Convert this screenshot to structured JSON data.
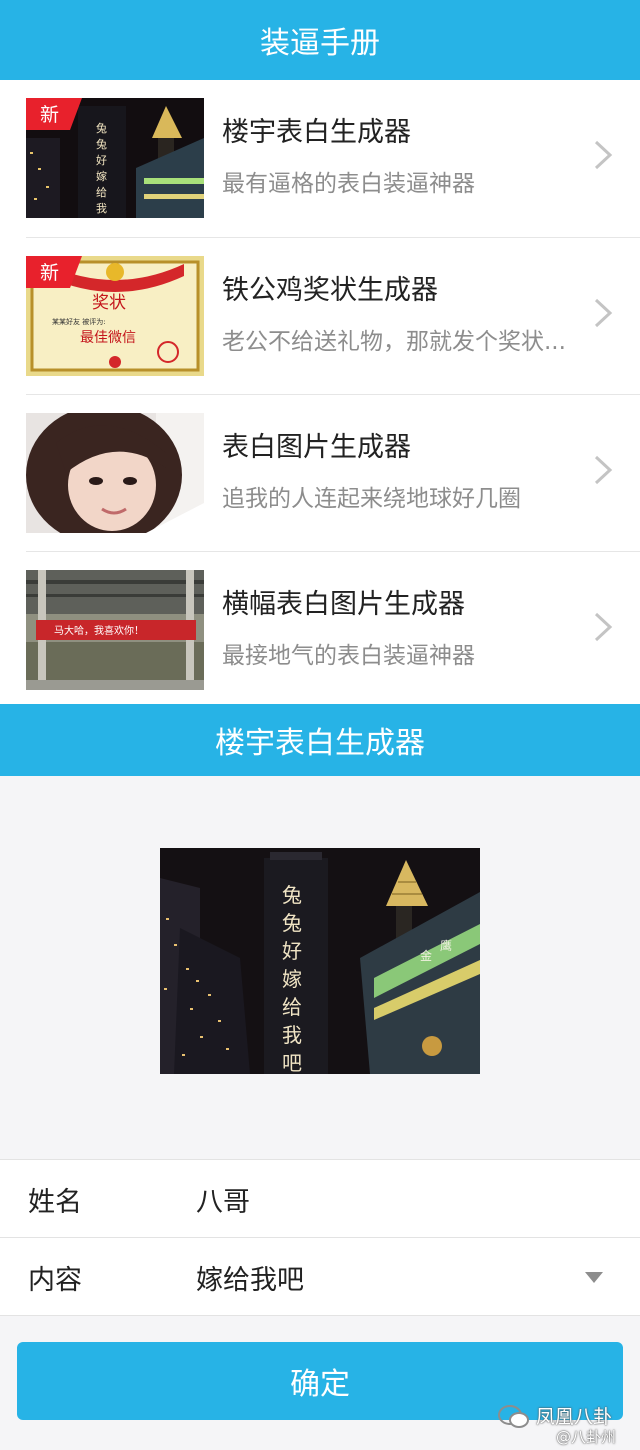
{
  "header": {
    "title": "装逼手册"
  },
  "list": {
    "items": [
      {
        "title": "楼宇表白生成器",
        "desc": "最有逼格的表白装逼神器",
        "badge": "新",
        "thumb_icon": "building-night-image"
      },
      {
        "title": "铁公鸡奖状生成器",
        "desc": "老公不给送礼物，那就发个奖状...",
        "badge": "新",
        "thumb_icon": "certificate-image",
        "thumb_texts": {
          "heading": "奖状",
          "line": "某某好友 被评为:",
          "award": "最佳微信"
        }
      },
      {
        "title": "表白图片生成器",
        "desc": "追我的人连起来绕地球好几圈",
        "thumb_icon": "portrait-photo"
      },
      {
        "title": "横幅表白图片生成器",
        "desc": "最接地气的表白装逼神器",
        "thumb_icon": "banner-photo",
        "thumb_texts": {
          "banner": "马大哈，我喜欢你！"
        }
      }
    ]
  },
  "section": {
    "title": "楼宇表白生成器"
  },
  "preview": {
    "vertical_text": "兔兔好嫁给我吧",
    "image_icon": "building-night-image"
  },
  "form": {
    "name_label": "姓名",
    "name_value": "八哥",
    "content_label": "内容",
    "content_value": "嫁给我吧"
  },
  "confirm_button": "确定",
  "watermark": {
    "text": "凤凰八卦",
    "sub": "@八卦州"
  },
  "colors": {
    "accent": "#27b3e6",
    "badge": "#e8212c"
  }
}
